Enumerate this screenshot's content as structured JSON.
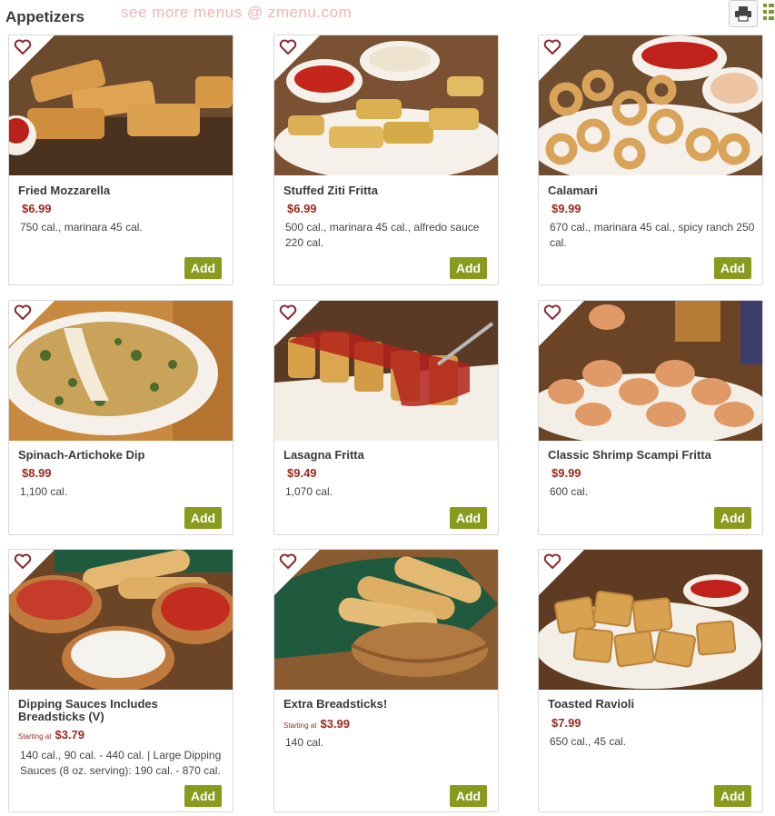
{
  "header": {
    "title": "Appetizers",
    "watermark": "see more menus @ zmenu.com"
  },
  "add_label": "Add",
  "items": [
    {
      "name": "Fried Mozzarella",
      "price": "$6.99",
      "starting": "",
      "calories": "750 cal., marinara 45 cal."
    },
    {
      "name": "Stuffed Ziti Fritta",
      "price": "$6.99",
      "starting": "",
      "calories": "500 cal., marinara 45 cal., alfredo sauce 220 cal."
    },
    {
      "name": "Calamari",
      "price": "$9.99",
      "starting": "",
      "calories": "670 cal., marinara 45 cal., spicy ranch 250 cal."
    },
    {
      "name": "Spinach-Artichoke Dip",
      "price": "$8.99",
      "starting": "",
      "calories": "1,100 cal."
    },
    {
      "name": "Lasagna Fritta",
      "price": "$9.49",
      "starting": "",
      "calories": "1,070 cal."
    },
    {
      "name": "Classic Shrimp Scampi Fritta",
      "price": "$9.99",
      "starting": "",
      "calories": "600 cal."
    },
    {
      "name": "Dipping Sauces Includes Breadsticks (V)",
      "price": "$3.79",
      "starting": "Starting at",
      "calories": "140 cal., 90 cal. - 440 cal. | Large Dipping Sauces (8 oz. serving): 190 cal. - 870 cal."
    },
    {
      "name": "Extra Breadsticks!",
      "price": "$3.99",
      "starting": "Starting at",
      "calories": "140 cal."
    },
    {
      "name": "Toasted Ravioli",
      "price": "$7.99",
      "starting": "",
      "calories": "650 cal., 45 cal."
    }
  ],
  "colors": {
    "price": "#9b2a1f",
    "add_button": "#8a9a1c",
    "watermark": "#f3b3b3"
  },
  "icons": {
    "favorite": "heart-icon",
    "print": "printer-icon",
    "view": "grid-icon"
  }
}
